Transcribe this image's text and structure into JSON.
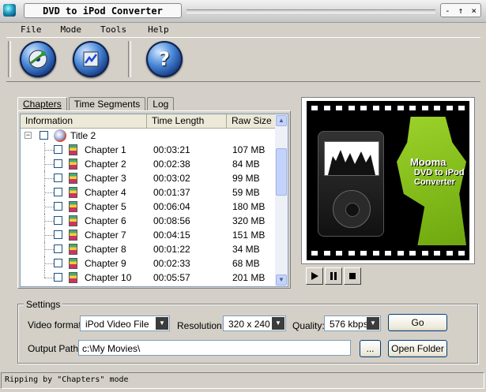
{
  "window": {
    "title": "DVD to iPod Converter",
    "controls": {
      "minimize": "-",
      "maximize": "↑",
      "close": "×"
    }
  },
  "menu": [
    "File",
    "Mode",
    "Tools",
    "Help"
  ],
  "toolbar": {
    "icons": [
      "open-dvd-icon",
      "convert-icon",
      "help-icon"
    ],
    "help_glyph": "?"
  },
  "tabs": [
    "Chapters",
    "Time Segments",
    "Log"
  ],
  "list": {
    "columns": [
      "Information",
      "Time Length",
      "Raw Size"
    ],
    "title_row": {
      "expander": "−",
      "name": "Title 2"
    },
    "chapters": [
      {
        "name": "Chapter 1",
        "time": "00:03:21",
        "size": "107 MB"
      },
      {
        "name": "Chapter 2",
        "time": "00:02:38",
        "size": "84 MB"
      },
      {
        "name": "Chapter 3",
        "time": "00:03:02",
        "size": "99 MB"
      },
      {
        "name": "Chapter 4",
        "time": "00:01:37",
        "size": "59 MB"
      },
      {
        "name": "Chapter 5",
        "time": "00:06:04",
        "size": "180 MB"
      },
      {
        "name": "Chapter 6",
        "time": "00:08:56",
        "size": "320 MB"
      },
      {
        "name": "Chapter 7",
        "time": "00:04:15",
        "size": "151 MB"
      },
      {
        "name": "Chapter 8",
        "time": "00:01:22",
        "size": "34 MB"
      },
      {
        "name": "Chapter 9",
        "time": "00:02:33",
        "size": "68 MB"
      },
      {
        "name": "Chapter 10",
        "time": "00:05:57",
        "size": "201 MB"
      }
    ]
  },
  "preview": {
    "brand": "Mooma",
    "product": "DVD to iPod Converter",
    "accent": "#8cc21e"
  },
  "player": {
    "play": "play-icon",
    "pause": "pause-icon",
    "stop": "stop-icon"
  },
  "settings": {
    "legend": "Settings",
    "video_format_label": "Video format:",
    "video_format_value": "iPod Video File",
    "resolution_label": "Resolution:",
    "resolution_value": "320 x 240",
    "quality_label": "Quality:",
    "quality_value": "576 kbps",
    "go_label": "Go",
    "output_path_label": "Output Path",
    "output_path_value": "c:\\My Movies\\",
    "browse_label": "...",
    "open_folder_label": "Open Folder",
    "dropdown_glyph": "▼"
  },
  "status": "Ripping by \"Chapters\" mode"
}
